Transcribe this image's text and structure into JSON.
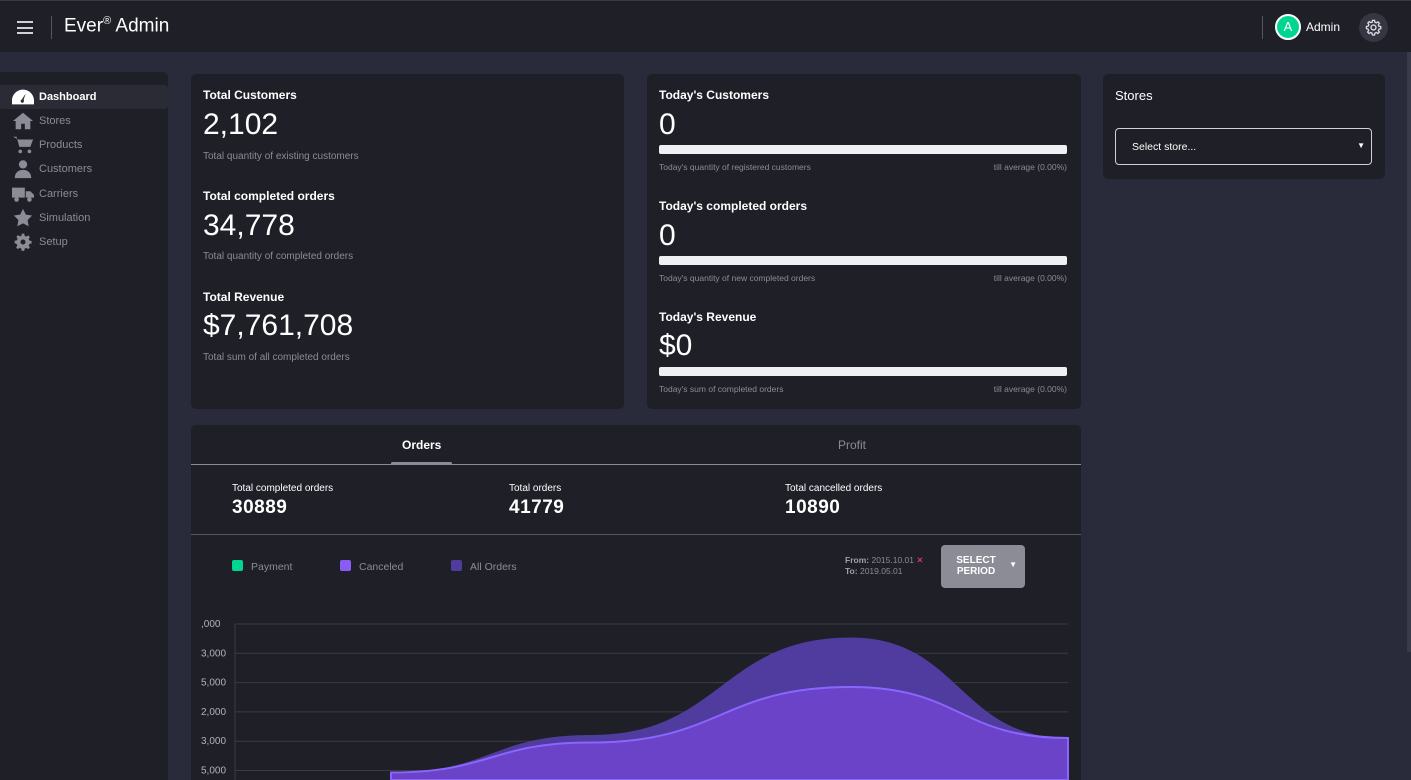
{
  "header": {
    "brand": "Ever",
    "brand_mark": "®",
    "brand_suffix": " Admin",
    "avatar_letter": "A",
    "user_name": "Admin"
  },
  "sidebar": {
    "items": [
      {
        "label": "Dashboard",
        "icon": "dashboard-icon",
        "active": true
      },
      {
        "label": "Stores",
        "icon": "home-icon",
        "active": false
      },
      {
        "label": "Products",
        "icon": "cart-icon",
        "active": false
      },
      {
        "label": "Customers",
        "icon": "person-icon",
        "active": false
      },
      {
        "label": "Carriers",
        "icon": "truck-icon",
        "active": false
      },
      {
        "label": "Simulation",
        "icon": "star-icon",
        "active": false
      },
      {
        "label": "Setup",
        "icon": "gear-icon",
        "active": false
      }
    ]
  },
  "totals": {
    "customers": {
      "title": "Total Customers",
      "value": "2,102",
      "desc": "Total quantity of existing customers"
    },
    "orders": {
      "title": "Total completed orders",
      "value": "34,778",
      "desc": "Total quantity of completed orders"
    },
    "revenue": {
      "title": "Total Revenue",
      "value": "$7,761,708",
      "desc": "Total sum of all completed orders"
    }
  },
  "today": {
    "customers": {
      "title": "Today's Customers",
      "value": "0",
      "desc": "Today's quantity of registered customers",
      "avg": "till average (0.00%)",
      "progress": 0
    },
    "orders": {
      "title": "Today's completed orders",
      "value": "0",
      "desc": "Today's quantity of new completed orders",
      "avg": "till average (0.00%)",
      "progress": 0
    },
    "revenue": {
      "title": "Today's Revenue",
      "value": "$0",
      "desc": "Today's sum of completed orders",
      "avg": "till average (0.00%)",
      "progress": 0
    }
  },
  "stores": {
    "title": "Stores",
    "placeholder": "Select store..."
  },
  "chart_panel": {
    "tabs": [
      {
        "label": "Orders",
        "active": true
      },
      {
        "label": "Profit",
        "active": false
      }
    ],
    "stats": [
      {
        "label": "Total completed orders",
        "value": "30889"
      },
      {
        "label": "Total orders",
        "value": "41779"
      },
      {
        "label": "Total cancelled orders",
        "value": "10890"
      }
    ],
    "legend": [
      {
        "label": "Payment",
        "color": "#00d68f"
      },
      {
        "label": "Canceled",
        "color": "#8a5cf6"
      },
      {
        "label": "All Orders",
        "color": "#4f3c9e"
      }
    ],
    "period_from_label": "From:",
    "period_from": "2015.10.01",
    "period_to_label": "To:",
    "period_to": "2019.05.01",
    "select_period": "SELECT PERIOD"
  },
  "chart_data": {
    "type": "area",
    "y_tick_labels": [
      ",000",
      "3,000",
      "5,000",
      "2,000",
      "3,000",
      "5,000"
    ],
    "series": [
      {
        "name": "All Orders",
        "color": "#4f3c9e",
        "values": [
          0.05,
          0.3,
          0.95,
          0.28
        ]
      },
      {
        "name": "Canceled",
        "color": "#6b43c9",
        "values": [
          0.05,
          0.25,
          0.62,
          0.28
        ]
      }
    ]
  },
  "colors": {
    "accent": "#00d68f",
    "bg": "#2a2b3a",
    "card": "#1e1f27"
  }
}
